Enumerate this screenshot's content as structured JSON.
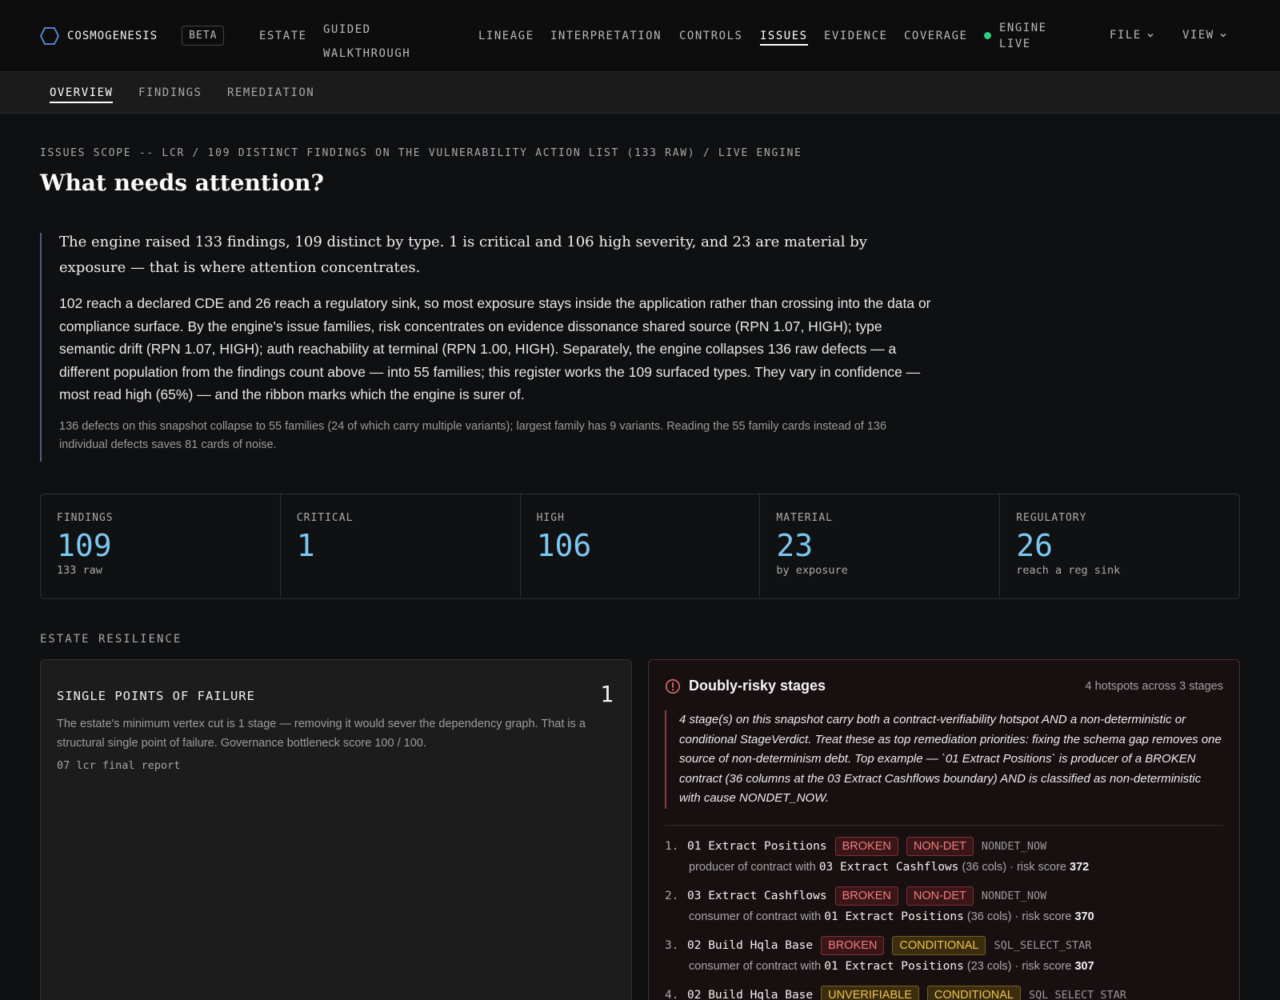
{
  "brand": {
    "name": "COSMOGENESIS",
    "beta": "BETA"
  },
  "nav": {
    "estate": "ESTATE",
    "guided_1": "GUIDED",
    "guided_2": "WALKTHROUGH",
    "lineage": "LINEAGE",
    "interpretation": "INTERPRETATION",
    "controls": "CONTROLS",
    "issues": "ISSUES",
    "evidence": "EVIDENCE",
    "coverage": "COVERAGE",
    "engine_1": "ENGINE",
    "engine_2": "LIVE",
    "file": "FILE",
    "view": "VIEW",
    "active": "ISSUES",
    "engine_status_color": "#2fcf7f"
  },
  "subnav": {
    "overview": "OVERVIEW",
    "findings": "FINDINGS",
    "remediation": "REMEDIATION",
    "active": "OVERVIEW"
  },
  "page": {
    "scope": "ISSUES SCOPE -- LCR / 109 DISTINCT FINDINGS ON THE VULNERABILITY ACTION LIST (133 RAW) / LIVE ENGINE",
    "title": "What needs attention?"
  },
  "summary": {
    "lead": "The engine raised 133 findings, 109 distinct by type. 1 is critical and 106 high severity, and 23 are material by exposure — that is where attention concentrates.",
    "body": "102 reach a declared CDE and 26 reach a regulatory sink, so most exposure stays inside the application rather than crossing into the data or compliance surface. By the engine's issue families, risk concentrates on evidence dissonance shared source (RPN 1.07, HIGH); type semantic drift (RPN 1.07, HIGH); auth reachability at terminal (RPN 1.00, HIGH). Separately, the engine collapses 136 raw defects — a different population from the findings count above — into 55 families; this register works the 109 surfaced types. They vary in confidence — most read high (65%) — and the ribbon marks which the engine is surer of.",
    "fine": "136 defects on this snapshot collapse to 55 families (24 of which carry multiple variants); largest family has 9 variants. Reading the 55 family cards instead of 136 individual defects saves 81 cards of noise."
  },
  "stats": [
    {
      "label": "FINDINGS",
      "value": "109",
      "sub": "133 raw"
    },
    {
      "label": "CRITICAL",
      "value": "1",
      "sub": ""
    },
    {
      "label": "HIGH",
      "value": "106",
      "sub": ""
    },
    {
      "label": "MATERIAL",
      "value": "23",
      "sub": "by exposure"
    },
    {
      "label": "REGULATORY",
      "value": "26",
      "sub": "reach a reg sink"
    }
  ],
  "resilience": {
    "section_label": "ESTATE RESILIENCE",
    "spof": {
      "title": "SINGLE POINTS OF FAILURE",
      "count": "1",
      "desc": "The estate's minimum vertex cut is 1 stage — removing it would sever the dependency graph. That is a structural single point of failure. Governance bottleneck score 100 / 100.",
      "stage": "07 lcr final report"
    },
    "risky": {
      "title": "Doubly-risky stages",
      "meta": "4 hotspots across 3 stages",
      "quote": "4 stage(s) on this snapshot carry both a contract-verifiability hotspot AND a non-deterministic or conditional StageVerdict. Treat these as top remediation priorities: fixing the schema gap removes one source of non-determinism debt. Top example — `01 Extract Positions` is producer of a BROKEN contract (36 columns at the 03 Extract Cashflows boundary) AND is classified as non-deterministic with cause NONDET_NOW.",
      "items": [
        {
          "num": "1.",
          "stage": "01 Extract Positions",
          "badge1": "BROKEN",
          "badge2": "NON-DET",
          "cause": "NONDET_NOW",
          "role": "producer of contract with",
          "peer": "03 Extract Cashflows",
          "cols": "(36 cols) · risk score",
          "score": "372"
        },
        {
          "num": "2.",
          "stage": "03 Extract Cashflows",
          "badge1": "BROKEN",
          "badge2": "NON-DET",
          "cause": "NONDET_NOW",
          "role": "consumer of contract with",
          "peer": "01 Extract Positions",
          "cols": "(36 cols) · risk score",
          "score": "370"
        },
        {
          "num": "3.",
          "stage": "02 Build Hqla Base",
          "badge1": "BROKEN",
          "badge2": "CONDITIONAL",
          "cause": "SQL_SELECT_STAR",
          "role": "consumer of contract with",
          "peer": "01 Extract Positions",
          "cols": "(23 cols) · risk score",
          "score": "307"
        },
        {
          "num": "4.",
          "stage": "02 Build Hqla Base",
          "badge1": "UNVERIFIABLE",
          "badge2": "CONDITIONAL",
          "cause": "SQL_SELECT_STAR",
          "role": "",
          "peer": "",
          "cols": "",
          "score": ""
        }
      ]
    }
  }
}
